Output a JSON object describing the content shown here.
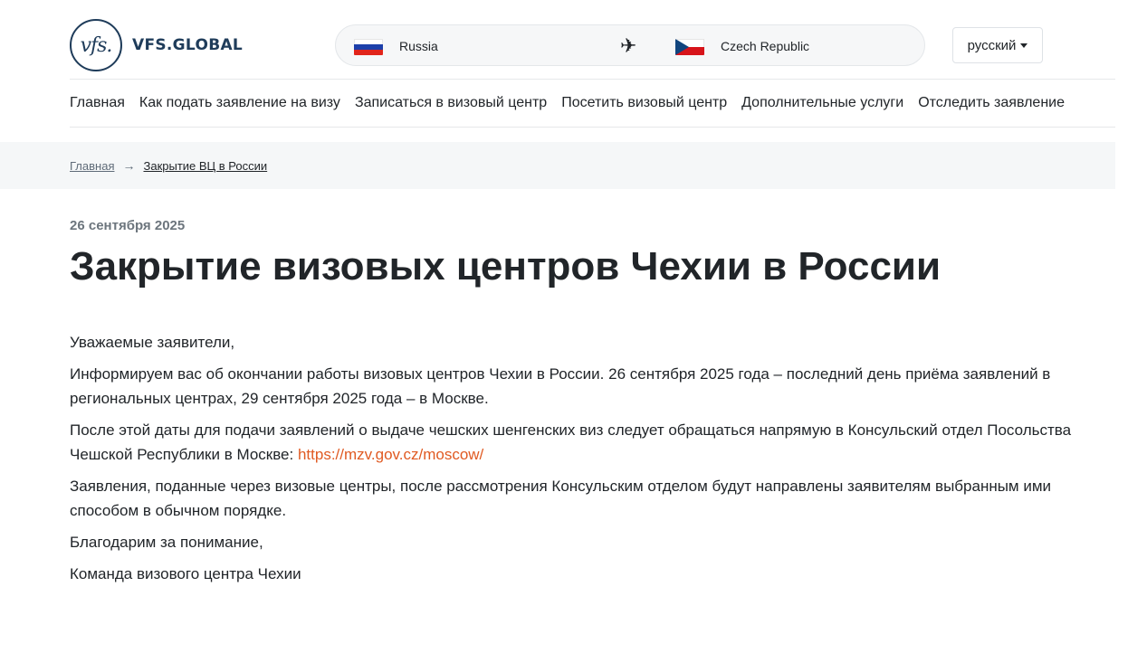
{
  "header": {
    "logo_mark": "vfs.",
    "logo_text": "VFS.GLOBAL",
    "route": {
      "from_country": "Russia",
      "to_country": "Czech Republic",
      "icon": "plane-icon"
    },
    "language": "русский"
  },
  "nav": {
    "items": [
      "Главная",
      "Как подать заявление на визу",
      "Записаться в визовый центр",
      "Посетить визовый центр",
      "Дополнительные услуги",
      "Отследить заявление"
    ]
  },
  "breadcrumb": {
    "home": "Главная",
    "current": "Закрытие ВЦ в России"
  },
  "article": {
    "date": "26 сентября 2025",
    "title": "Закрытие визовых центров Чехии в России",
    "greeting": "Уважаемые заявители,",
    "p1": "Информируем вас об окончании работы визовых центров Чехии в России. 26 сентября 2025 года – последний день приёма заявлений в региональных центрах, 29 сентября 2025 года – в Москве.",
    "p2_text": "После этой даты для подачи заявлений о выдаче чешских шенгенских виз следует обращаться напрямую в Консульский отдел Посольства Чешской Республики в Москве: ",
    "p2_link": "https://mzv.gov.cz/moscow/",
    "p3": "Заявления, поданные через визовые центры, после рассмотрения Консульским отделом будут направлены заявителям выбранным ими способом в обычном порядке.",
    "thanks": "Благодарим за понимание,",
    "signature": "Команда визового центра Чехии"
  },
  "colors": {
    "brand": "#1f3c5a",
    "link": "#e05a22",
    "breadcrumb_bg": "#f5f7f8"
  }
}
